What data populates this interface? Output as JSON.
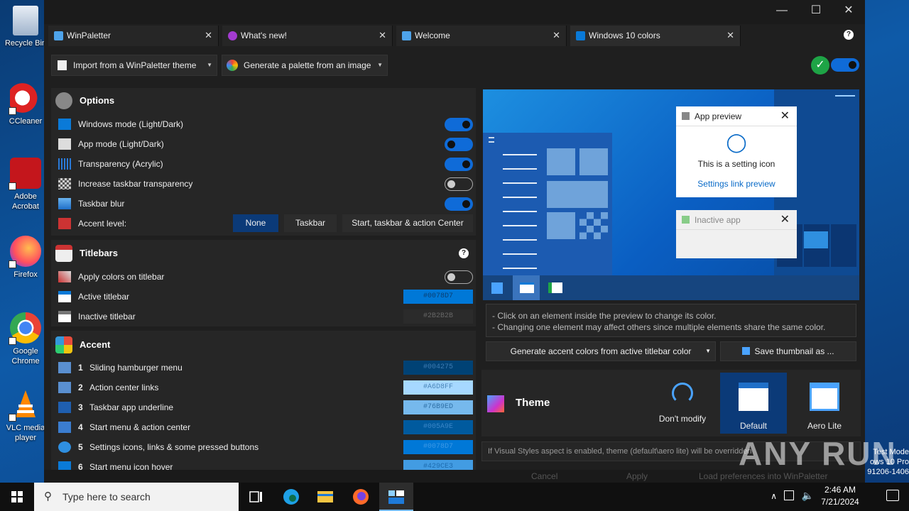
{
  "desktop": {
    "icons": [
      {
        "label": "Recycle Bin"
      },
      {
        "label": "CCleaner"
      },
      {
        "label": "Adobe Acrobat"
      },
      {
        "label": "Firefox"
      },
      {
        "label": "Google Chrome"
      },
      {
        "label": "VLC media player"
      }
    ]
  },
  "window": {
    "tabs": [
      {
        "label": "WinPaletter",
        "icon": "winpaletter-icon"
      },
      {
        "label": "What's new!",
        "icon": "whats-new-icon"
      },
      {
        "label": "Welcome",
        "icon": "winpaletter-icon"
      },
      {
        "label": "Windows 10 colors",
        "icon": "windows-logo-icon"
      }
    ],
    "toolbar": {
      "import_label": "Import from a WinPaletter theme",
      "generate_label": "Generate a palette from an image"
    },
    "options": {
      "title": "Options",
      "rows": [
        {
          "label": "Windows mode (Light/Dark)",
          "toggle": "on"
        },
        {
          "label": "App mode (Light/Dark)",
          "toggle": "on"
        },
        {
          "label": "Transparency (Acrylic)",
          "toggle": "on"
        },
        {
          "label": "Increase taskbar transparency",
          "toggle": "off"
        },
        {
          "label": "Taskbar blur",
          "toggle": "on"
        }
      ],
      "accent_level": {
        "label": "Accent level:",
        "options": [
          "None",
          "Taskbar",
          "Start, taskbar & action Center"
        ],
        "selected": "None"
      }
    },
    "titlebars": {
      "title": "Titlebars",
      "apply_label": "Apply colors on titlebar",
      "active_label": "Active titlebar",
      "active_color": "#0078D7",
      "inactive_label": "Inactive titlebar",
      "inactive_color": "#2B2B2B"
    },
    "accent": {
      "title": "Accent",
      "rows": [
        {
          "num": "1",
          "label": "Sliding hamburger menu",
          "color": "#004275"
        },
        {
          "num": "2",
          "label": "Action center links",
          "color": "#A6D8FF"
        },
        {
          "num": "3",
          "label": "Taskbar app underline",
          "color": "#76B9ED"
        },
        {
          "num": "4",
          "label": "Start menu & action center",
          "color": "#005A9E"
        },
        {
          "num": "5",
          "label": "Settings icons, links & some pressed buttons",
          "color": "#0078D7"
        },
        {
          "num": "6",
          "label": "Start menu icon hover",
          "color": "#429CE3"
        }
      ]
    },
    "preview": {
      "app_title": "App preview",
      "setting_text": "This is a setting icon",
      "link_text": "Settings link preview",
      "inactive_title": "Inactive app"
    },
    "hints": {
      "line1": "- Click on an element inside the preview to change its color.",
      "line2": "- Changing one element may affect others since multiple elements share the same color."
    },
    "generate_accent_label": "Generate accent colors from active titlebar color",
    "save_thumb_label": "Save thumbnail as ...",
    "theme": {
      "title": "Theme",
      "options": [
        {
          "label": "Don't modify"
        },
        {
          "label": "Default"
        },
        {
          "label": "Aero Lite"
        }
      ],
      "selected": "Default"
    },
    "visual_styles_note": "If Visual Styles aspect is enabled, theme (default\\aero lite) will be overridden",
    "footer": {
      "cancel": "Cancel",
      "apply": "Apply",
      "load_prefs": "Load preferences into WinPaletter"
    }
  },
  "taskbar": {
    "search_placeholder": "Type here to search",
    "time": "2:46 AM",
    "date": "7/21/2024"
  },
  "watermark": {
    "line1": "Test Mode",
    "line2": "ows 10 Pro",
    "line3": "91206-1406",
    "brand": "ANY RUN"
  },
  "colors": {
    "accent_blue": "#0f6bd8",
    "window_bg": "#1f1f1f",
    "card_bg": "#262626",
    "selected_seg": "#0b3a78"
  }
}
